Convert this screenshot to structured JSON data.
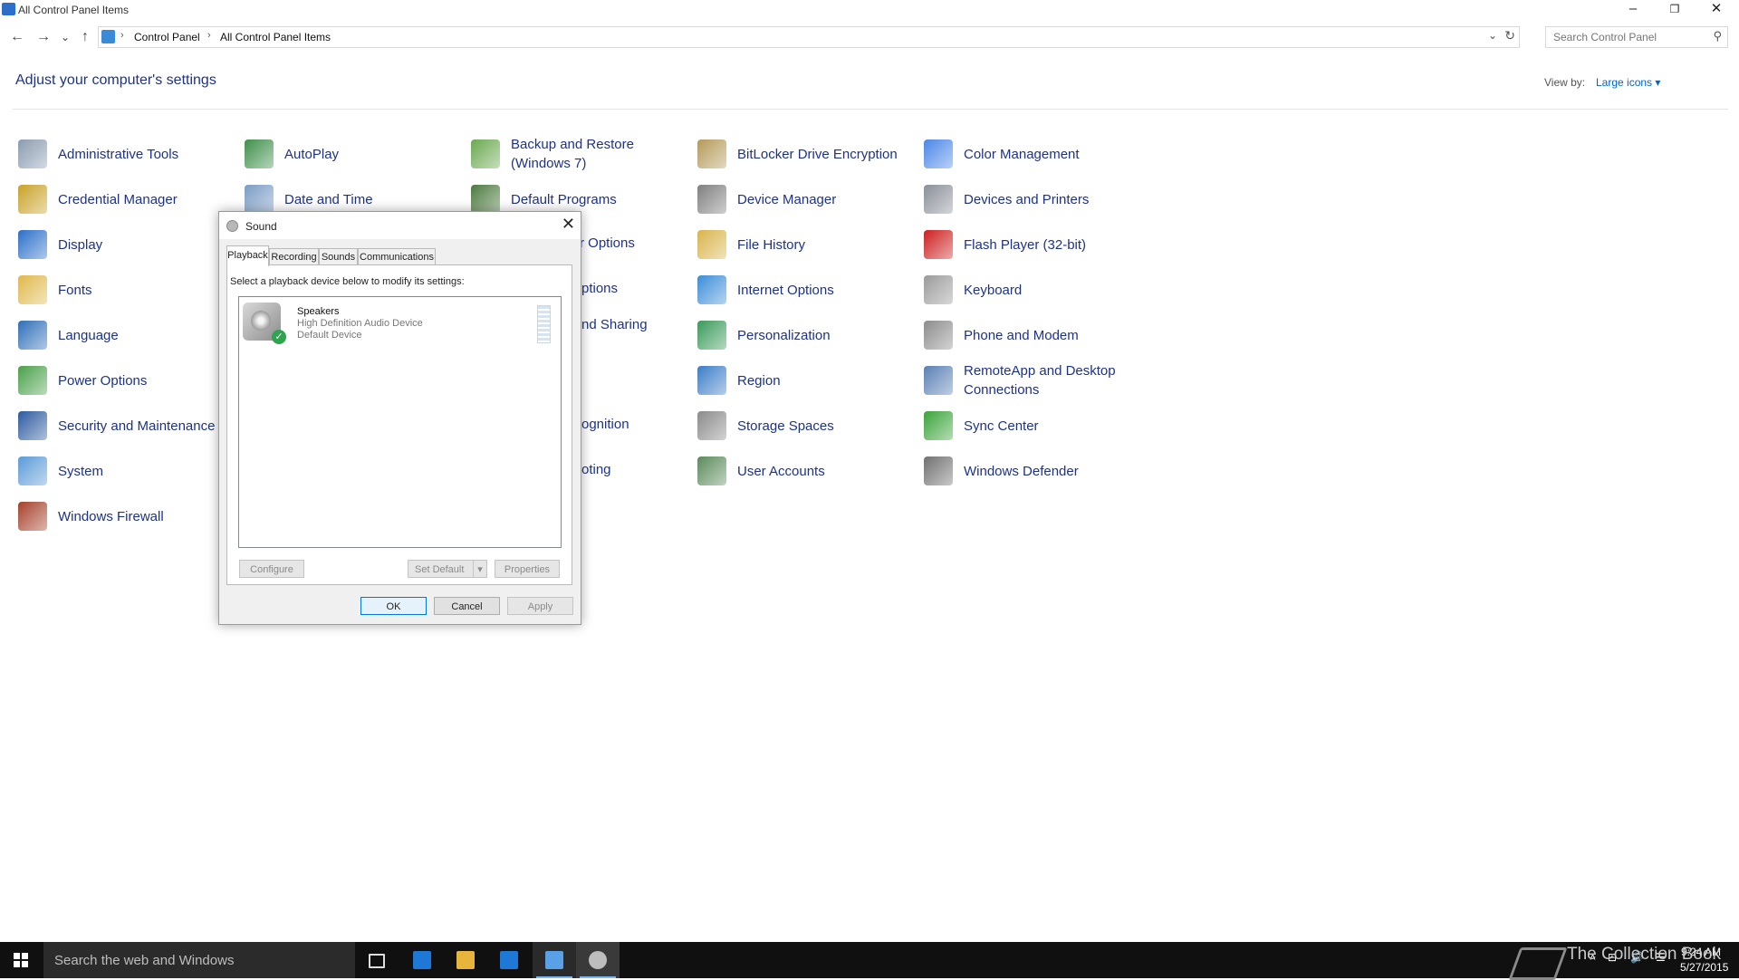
{
  "window": {
    "title": "All Control Panel Items",
    "controls": {
      "minimize": "–",
      "restore": "❐",
      "close": "✕"
    }
  },
  "nav": {
    "back": "←",
    "forward": "→",
    "recent": "⌄",
    "up": "↑",
    "breadcrumb": [
      "Control Panel",
      "All Control Panel Items"
    ],
    "separator": "›",
    "dropdown": "⌄",
    "refresh": "↻"
  },
  "search": {
    "placeholder": "Search Control Panel",
    "icon": "⚲"
  },
  "header": {
    "title": "Adjust your computer's settings",
    "view_by_label": "View by:",
    "view_by_value": "Large icons ▾"
  },
  "items": [
    {
      "label": "Administrative Tools",
      "icon": "admin-tools-icon",
      "color": "#8a9bb0"
    },
    {
      "label": "AutoPlay",
      "icon": "autoplay-icon",
      "color": "#3f8f4a"
    },
    {
      "label": "Backup and Restore (Windows 7)",
      "icon": "backup-restore-icon",
      "color": "#6aa84f"
    },
    {
      "label": "BitLocker Drive Encryption",
      "icon": "bitlocker-icon",
      "color": "#b49a5a"
    },
    {
      "label": "Color Management",
      "icon": "color-management-icon",
      "color": "#4a86e8"
    },
    {
      "label": "Credential Manager",
      "icon": "credential-manager-icon",
      "color": "#c9a227"
    },
    {
      "label": "Date and Time",
      "icon": "date-time-icon",
      "color": "#7a9cc6"
    },
    {
      "label": "Default Programs",
      "icon": "default-programs-icon",
      "color": "#4c7a3f"
    },
    {
      "label": "Device Manager",
      "icon": "device-manager-icon",
      "color": "#7f7f7f"
    },
    {
      "label": "Devices and Printers",
      "icon": "devices-printers-icon",
      "color": "#8a9099"
    },
    {
      "label": "Display",
      "icon": "display-icon",
      "color": "#2b6fc9"
    },
    {
      "label": "File History",
      "icon": "file-history-icon",
      "color": "#d9b44a"
    },
    {
      "label": "Flash Player (32-bit)",
      "icon": "flash-player-icon",
      "color": "#cc1f1f"
    },
    {
      "label": "Fonts",
      "icon": "fonts-icon",
      "color": "#e0b84a"
    },
    {
      "label": "Internet Options",
      "icon": "internet-options-icon",
      "color": "#3c8dd8"
    },
    {
      "label": "Keyboard",
      "icon": "keyboard-icon",
      "color": "#9a9a9a"
    },
    {
      "label": "Language",
      "icon": "language-icon",
      "color": "#2e6fb8"
    },
    {
      "label": "Personalization",
      "icon": "personalization-icon",
      "color": "#3a9a5a"
    },
    {
      "label": "Phone and Modem",
      "icon": "phone-modem-icon",
      "color": "#8c8c8c"
    },
    {
      "label": "Power Options",
      "icon": "power-options-icon",
      "color": "#4aa04a"
    },
    {
      "label": "Region",
      "icon": "region-icon",
      "color": "#3c7dc8"
    },
    {
      "label": "RemoteApp and Desktop Connections",
      "icon": "remoteapp-icon",
      "color": "#5a7fb5"
    },
    {
      "label": "Security and Maintenance",
      "icon": "security-maintenance-icon",
      "color": "#2c5aa0"
    },
    {
      "label": "Storage Spaces",
      "icon": "storage-spaces-icon",
      "color": "#8a8a8a"
    },
    {
      "label": "Sync Center",
      "icon": "sync-center-icon",
      "color": "#3aa33a"
    },
    {
      "label": "System",
      "icon": "system-icon",
      "color": "#5a9ad8"
    },
    {
      "label": "User Accounts",
      "icon": "user-accounts-icon",
      "color": "#5b8a5b"
    },
    {
      "label": "Windows Defender",
      "icon": "windows-defender-icon",
      "color": "#707070"
    },
    {
      "label": "Windows Firewall",
      "icon": "windows-firewall-icon",
      "color": "#a5402a"
    }
  ],
  "partial_items": [
    {
      "label": "r Options"
    },
    {
      "label": "ptions"
    },
    {
      "label": "nd Sharing"
    },
    {
      "label": "ognition"
    },
    {
      "label": "oting"
    }
  ],
  "dialog": {
    "title": "Sound",
    "close": "✕",
    "tabs": [
      "Playback",
      "Recording",
      "Sounds",
      "Communications"
    ],
    "active_tab": "Playback",
    "instruction": "Select a playback device below to modify its settings:",
    "device": {
      "name": "Speakers",
      "description": "High Definition Audio Device",
      "status": "Default Device",
      "check": "✓"
    },
    "buttons": {
      "configure": "Configure",
      "set_default": "Set Default",
      "set_default_arrow": "▾",
      "properties": "Properties",
      "ok": "OK",
      "cancel": "Cancel",
      "apply": "Apply"
    }
  },
  "taskbar": {
    "search_placeholder": "Search the web and Windows",
    "watermark": "The Collection Book",
    "time": "9:24 AM",
    "date": "5/27/2015",
    "tray_icons": [
      "up-arrow-icon",
      "network-icon",
      "volume-icon",
      "notifications-icon"
    ],
    "tray_glyphs": [
      "˄",
      "⊟",
      "🔊",
      "☰"
    ]
  }
}
